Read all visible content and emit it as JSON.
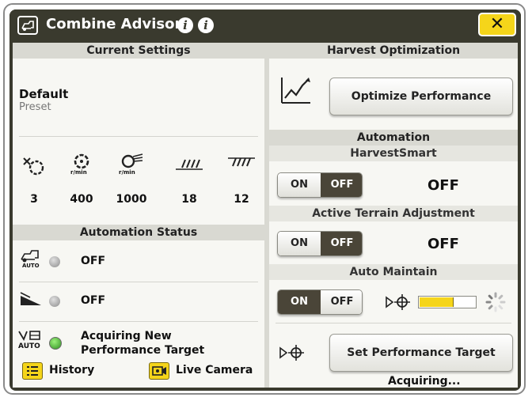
{
  "window": {
    "title": "Combine Advisor",
    "info_icon_1": "i",
    "info_icon_2": "i",
    "close_label": "✕"
  },
  "current_settings": {
    "header": "Current Settings",
    "preset_name": "Default",
    "preset_label": "Preset",
    "settings": [
      {
        "icon": "concave-clearance-icon",
        "unit": "",
        "value": "3"
      },
      {
        "icon": "rotor-speed-icon",
        "unit": "r/min",
        "value": "400"
      },
      {
        "icon": "fan-speed-icon",
        "unit": "r/min",
        "value": "1000"
      },
      {
        "icon": "chaffer-icon",
        "unit": "",
        "value": "18"
      },
      {
        "icon": "sieve-icon",
        "unit": "",
        "value": "12"
      }
    ]
  },
  "automation_status": {
    "header": "Automation Status",
    "rows": [
      {
        "icon": "harvestsmart-auto-icon",
        "icon_label": "AUTO",
        "status": "OFF",
        "led": "grey"
      },
      {
        "icon": "terrain-slope-icon",
        "icon_label": "",
        "status": "OFF",
        "led": "grey"
      },
      {
        "icon": "auto-maintain-icon",
        "icon_label": "AUTO",
        "status": "Acquiring New Performance Target",
        "led": "green"
      }
    ]
  },
  "footer": {
    "history_label": "History",
    "live_camera_label": "Live Camera"
  },
  "harvest_optimization": {
    "header": "Harvest Optimization",
    "optimize_button": "Optimize Performance"
  },
  "automation": {
    "header": "Automation",
    "harvestsmart": {
      "header": "HarvestSmart",
      "on": "ON",
      "off": "OFF",
      "selected": "OFF",
      "status": "OFF"
    },
    "terrain": {
      "header": "Active Terrain Adjustment",
      "on": "ON",
      "off": "OFF",
      "selected": "OFF",
      "status": "OFF"
    },
    "auto_maintain": {
      "header": "Auto Maintain",
      "on": "ON",
      "off": "OFF",
      "selected": "ON",
      "progress": 0.6
    },
    "set_target_button": "Set Performance Target",
    "acquiring_text": "Acquiring..."
  },
  "colors": {
    "accent_yellow": "#f5d51a",
    "title_bar": "#3a3a2e",
    "toggle_active": "#4a4538",
    "led_green": "#3fb52a"
  }
}
